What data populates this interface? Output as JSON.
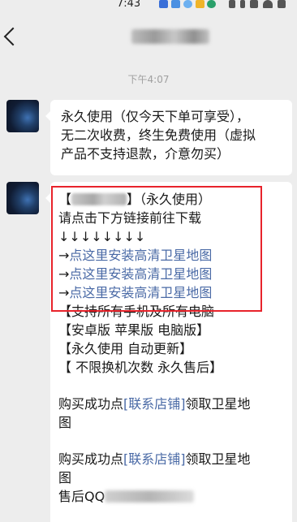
{
  "status_bar": {
    "time": "7:43"
  },
  "nav": {
    "title": ""
  },
  "chat": {
    "timestamp": "下午4:07",
    "message1": {
      "lines": [
        "永久使用（仅今天下单可享受），",
        "无二次收费，终生免费使用（虚拟",
        "产品不支持退款，介意勿买）"
      ]
    },
    "message2": {
      "title_open": "【",
      "title_close": "】（永久使用）",
      "download_hint": "请点击下方链接前往下载",
      "arrows": "↓↓↓↓↓↓↓↓",
      "link_prefix": "→",
      "links": [
        "点这里安装高清卫星地图",
        "点这里安装高清卫星地图",
        "点这里安装高清卫星地图"
      ],
      "features": [
        "【支持所有手机及所有电脑",
        "【安卓版   苹果版    电脑版】",
        "【永久使用          自动更新】",
        "【 不限换机次数   永久售后】"
      ],
      "purchase_prefix": "购买成功点",
      "store_link": "[联系店铺]",
      "purchase_suffix_1": "领取卫星地",
      "purchase_suffix_2": "图",
      "after_sales": "售后QQ"
    }
  },
  "colors": {
    "link": "#4a6aa6",
    "highlight": "#e8232b",
    "background": "#ededed",
    "bubble": "#ffffff"
  }
}
